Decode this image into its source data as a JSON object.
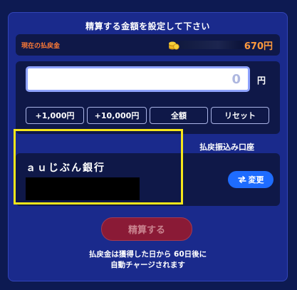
{
  "title": "精算する金額を設定して下さい",
  "refund": {
    "label": "現在の払戻金",
    "value": "670円",
    "icon": "coin-stack-icon"
  },
  "amount": {
    "value": "0",
    "unit": "円"
  },
  "quick_buttons": [
    "+1,000円",
    "+10,000円",
    "全額",
    "リセット"
  ],
  "account": {
    "header": "払戻振込み口座",
    "bank_name": "ａｕじぶん銀行",
    "change_label": "変更",
    "change_icon": "swap-arrows-icon"
  },
  "settle_label": "精算する",
  "note": {
    "line1": "払戻金は獲得した日から 60日後に",
    "line2": "自動チャージされます"
  },
  "colors": {
    "background": "#0d1a52",
    "panel": "#1a2a8c",
    "inner": "#0f1848",
    "accent_orange": "#ff9a3c",
    "change_button": "#1e6cff",
    "settle_button": "#8a1a36",
    "highlight": "#f5e61a"
  }
}
